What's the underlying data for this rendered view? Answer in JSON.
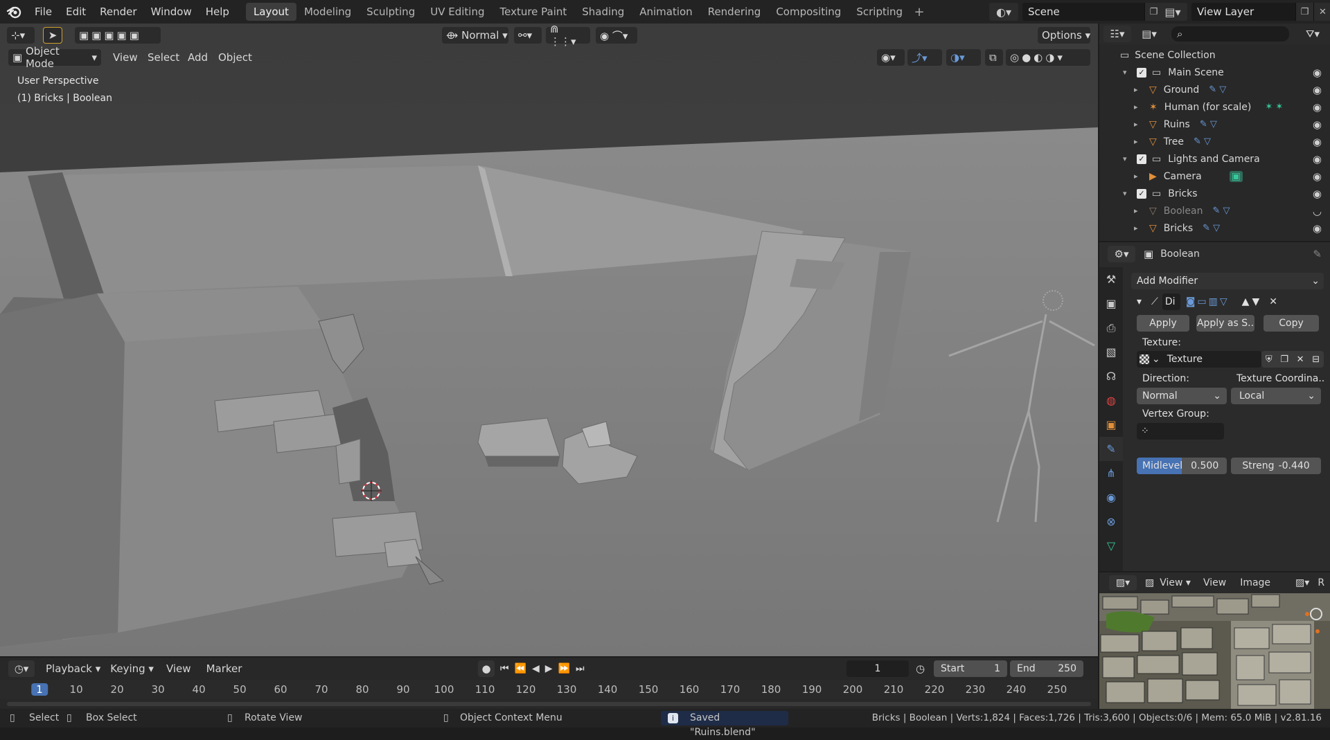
{
  "topbar": {
    "menus": [
      "File",
      "Edit",
      "Render",
      "Window",
      "Help"
    ],
    "workspaces": [
      "Layout",
      "Modeling",
      "Sculpting",
      "UV Editing",
      "Texture Paint",
      "Shading",
      "Animation",
      "Rendering",
      "Compositing",
      "Scripting"
    ],
    "active_workspace": "Layout",
    "scene": "Scene",
    "view_layer": "View Layer"
  },
  "viewport": {
    "header": {
      "mode": "Object Mode",
      "menus": [
        "View",
        "Select",
        "Add",
        "Object"
      ],
      "orientation": "Normal",
      "options": "Options"
    },
    "overlay": {
      "perspective": "User Perspective",
      "active": "(1) Bricks | Boolean"
    }
  },
  "outliner": {
    "root": "Scene Collection",
    "rows": [
      {
        "label": "Main Scene",
        "type": "collection"
      },
      {
        "label": "Ground",
        "type": "object"
      },
      {
        "label": "Human (for scale)",
        "type": "armature"
      },
      {
        "label": "Ruins",
        "type": "object"
      },
      {
        "label": "Tree",
        "type": "object"
      },
      {
        "label": "Lights and Camera",
        "type": "collection"
      },
      {
        "label": "Camera",
        "type": "camera"
      },
      {
        "label": "Bricks",
        "type": "collection"
      },
      {
        "label": "Boolean",
        "type": "object-disabled"
      },
      {
        "label": "Bricks",
        "type": "object"
      }
    ]
  },
  "properties": {
    "object_name": "Boolean",
    "add_modifier": "Add Modifier",
    "modifier_name": "Di",
    "apply": "Apply",
    "apply_shape": "Apply as S..",
    "copy": "Copy",
    "texture_label": "Texture:",
    "texture_value": "Texture",
    "direction_label": "Direction:",
    "texcoord_label": "Texture Coordina..",
    "direction_value": "Normal",
    "texcoord_value": "Local",
    "vertex_group_label": "Vertex Group:",
    "midlevel_label": "Midlevel",
    "midlevel_value": "0.500",
    "midlevel_fraction": 0.5,
    "strength_label": "Streng",
    "strength_value": "-0.440"
  },
  "image_editor": {
    "menus": [
      "View",
      "View",
      "Image"
    ],
    "right_label": "R"
  },
  "timeline": {
    "menus": [
      "Playback",
      "Keying",
      "View",
      "Marker"
    ],
    "current_frame": "1",
    "start_label": "Start",
    "start_value": "1",
    "end_label": "End",
    "end_value": "250",
    "ruler": [
      "1",
      "10",
      "20",
      "30",
      "40",
      "50",
      "60",
      "70",
      "80",
      "90",
      "100",
      "110",
      "120",
      "130",
      "140",
      "150",
      "160",
      "170",
      "180",
      "190",
      "200",
      "210",
      "220",
      "230",
      "240",
      "250"
    ]
  },
  "statusbar": {
    "select": "Select",
    "box_select": "Box Select",
    "rotate_view": "Rotate View",
    "context_menu": "Object Context Menu",
    "saved": "Saved \"Ruins.blend\"",
    "stats": "Bricks | Boolean | Verts:1,824 | Faces:1,726 | Tris:3,600 | Objects:0/6 | Mem: 65.0 MiB | v2.81.16"
  },
  "colors": {
    "accent": "#4772b3",
    "object_orange": "#e08f3a",
    "mesh_green": "#38c79a",
    "modifier_blue": "#6a9ad8"
  }
}
